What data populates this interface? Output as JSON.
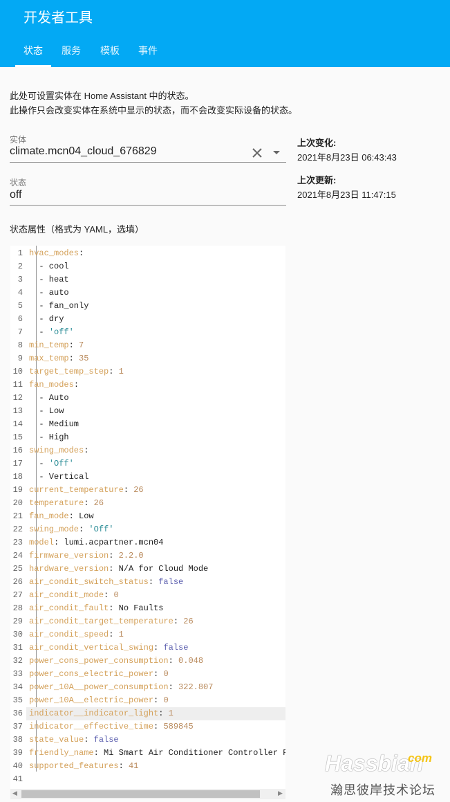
{
  "header": {
    "title": "开发者工具",
    "tabs": [
      {
        "label": "状态",
        "active": true
      },
      {
        "label": "服务"
      },
      {
        "label": "模板"
      },
      {
        "label": "事件"
      }
    ]
  },
  "description": [
    "此处可设置实体在 Home Assistant 中的状态。",
    "此操作只会改变实体在系统中显示的状态，而不会改变实际设备的状态。"
  ],
  "entity": {
    "label": "实体",
    "value": "climate.mcn04_cloud_676829",
    "clear_icon": "close-icon",
    "dropdown_icon": "caret-down-icon"
  },
  "state": {
    "label": "状态",
    "value": "off"
  },
  "last_changed": {
    "label": "上次变化:",
    "value": "2021年8月23日 06:43:43"
  },
  "last_updated": {
    "label": "上次更新:",
    "value": "2021年8月23日 11:47:15"
  },
  "attributes_label": "状态属性（格式为 YAML，选填）",
  "colors": {
    "header": "#03a9f4",
    "key": "#d4a15a",
    "number": "#b98a5c",
    "boolean": "#5c5fae",
    "quoted": "#2a8c96"
  },
  "highlighted_line": 36,
  "code_lines": [
    [
      [
        "k",
        "hvac_modes"
      ],
      [
        "p",
        ":"
      ]
    ],
    [
      [
        "p",
        "  - cool"
      ]
    ],
    [
      [
        "p",
        "  - heat"
      ]
    ],
    [
      [
        "p",
        "  - auto"
      ]
    ],
    [
      [
        "p",
        "  - fan_only"
      ]
    ],
    [
      [
        "p",
        "  - dry"
      ]
    ],
    [
      [
        "p",
        "  - "
      ],
      [
        "s",
        "'off'"
      ]
    ],
    [
      [
        "k",
        "min_temp"
      ],
      [
        "p",
        ": "
      ],
      [
        "n",
        "7"
      ]
    ],
    [
      [
        "k",
        "max_temp"
      ],
      [
        "p",
        ": "
      ],
      [
        "n",
        "35"
      ]
    ],
    [
      [
        "k",
        "target_temp_step"
      ],
      [
        "p",
        ": "
      ],
      [
        "n",
        "1"
      ]
    ],
    [
      [
        "k",
        "fan_modes"
      ],
      [
        "p",
        ":"
      ]
    ],
    [
      [
        "p",
        "  - Auto"
      ]
    ],
    [
      [
        "p",
        "  - Low"
      ]
    ],
    [
      [
        "p",
        "  - Medium"
      ]
    ],
    [
      [
        "p",
        "  - High"
      ]
    ],
    [
      [
        "k",
        "swing_modes"
      ],
      [
        "p",
        ":"
      ]
    ],
    [
      [
        "p",
        "  - "
      ],
      [
        "s",
        "'Off'"
      ]
    ],
    [
      [
        "p",
        "  - Vertical"
      ]
    ],
    [
      [
        "k",
        "current_temperature"
      ],
      [
        "p",
        ": "
      ],
      [
        "n",
        "26"
      ]
    ],
    [
      [
        "k",
        "temperature"
      ],
      [
        "p",
        ": "
      ],
      [
        "n",
        "26"
      ]
    ],
    [
      [
        "k",
        "fan_mode"
      ],
      [
        "p",
        ": Low"
      ]
    ],
    [
      [
        "k",
        "swing_mode"
      ],
      [
        "p",
        ": "
      ],
      [
        "s",
        "'Off'"
      ]
    ],
    [
      [
        "k",
        "model"
      ],
      [
        "p",
        ": lumi.acpartner.mcn04"
      ]
    ],
    [
      [
        "k",
        "firmware_version"
      ],
      [
        "p",
        ": "
      ],
      [
        "n",
        "2.2.0"
      ]
    ],
    [
      [
        "k",
        "hardware_version"
      ],
      [
        "p",
        ": N/A for Cloud Mode"
      ]
    ],
    [
      [
        "k",
        "air_condit_switch_status"
      ],
      [
        "p",
        ": "
      ],
      [
        "b",
        "false"
      ]
    ],
    [
      [
        "k",
        "air_condit_mode"
      ],
      [
        "p",
        ": "
      ],
      [
        "n",
        "0"
      ]
    ],
    [
      [
        "k",
        "air_condit_fault"
      ],
      [
        "p",
        ": No Faults"
      ]
    ],
    [
      [
        "k",
        "air_condit_target_temperature"
      ],
      [
        "p",
        ": "
      ],
      [
        "n",
        "26"
      ]
    ],
    [
      [
        "k",
        "air_condit_speed"
      ],
      [
        "p",
        ": "
      ],
      [
        "n",
        "1"
      ]
    ],
    [
      [
        "k",
        "air_condit_vertical_swing"
      ],
      [
        "p",
        ": "
      ],
      [
        "b",
        "false"
      ]
    ],
    [
      [
        "k",
        "power_cons_power_consumption"
      ],
      [
        "p",
        ": "
      ],
      [
        "n",
        "0.048"
      ]
    ],
    [
      [
        "k",
        "power_cons_electric_power"
      ],
      [
        "p",
        ": "
      ],
      [
        "n",
        "0"
      ]
    ],
    [
      [
        "k",
        "power_10A__power_consumption"
      ],
      [
        "p",
        ": "
      ],
      [
        "n",
        "322.807"
      ]
    ],
    [
      [
        "k",
        "power_10A__electric_power"
      ],
      [
        "p",
        ": "
      ],
      [
        "n",
        "0"
      ]
    ],
    [
      [
        "k",
        "indicator__indicator_light"
      ],
      [
        "p",
        ": "
      ],
      [
        "n",
        "1"
      ]
    ],
    [
      [
        "k",
        "indicator__effective_time"
      ],
      [
        "p",
        ": "
      ],
      [
        "n",
        "589845"
      ]
    ],
    [
      [
        "k",
        "state_value"
      ],
      [
        "p",
        ": "
      ],
      [
        "b",
        "false"
      ]
    ],
    [
      [
        "k",
        "friendly_name"
      ],
      [
        "p",
        ": Mi Smart Air Conditioner Controller Pr"
      ]
    ],
    [
      [
        "k",
        "supported_features"
      ],
      [
        "p",
        ": "
      ],
      [
        "n",
        "41"
      ]
    ],
    []
  ],
  "watermark": {
    "brand": "Hassbian",
    "suffix": "com",
    "forum": "瀚思彼岸技术论坛"
  }
}
